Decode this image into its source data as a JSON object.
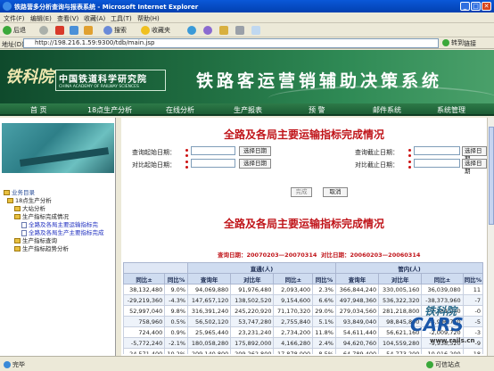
{
  "window": {
    "title": "铁路营多分析查询与报表系统 - Microsoft Internet Explorer",
    "controls": [
      "_",
      "□",
      "✕"
    ]
  },
  "menu": [
    "文件(F)",
    "编辑(E)",
    "查看(V)",
    "收藏(A)",
    "工具(T)",
    "帮助(H)"
  ],
  "toolbar": {
    "back": "后退",
    "search": "搜索",
    "favorites": "收藏夹"
  },
  "address": {
    "label": "地址(D)",
    "url": "http://198.216.1.59:9300/tdb/main.jsp",
    "go": "转到",
    "links": "链接"
  },
  "banner": {
    "logo_script": "铁科院",
    "logo_cn": "中国铁道科学研究院",
    "logo_en": "CHINA ACADEMY OF RAILWAY SCIENCES",
    "system_title": "铁路客运营销辅助决策系统"
  },
  "nav": [
    "首 页",
    "18点生产分析",
    "在线分析",
    "生产报表",
    "预 警",
    "邮件系统",
    "系统管理"
  ],
  "sidebar": {
    "tree": [
      {
        "label": "业务目录",
        "level": 0,
        "type": "root"
      },
      {
        "label": "18点生产分析",
        "level": 1,
        "type": "folder"
      },
      {
        "label": "大站分析",
        "level": 2,
        "type": "folder"
      },
      {
        "label": "生产指标完成情况",
        "level": 2,
        "type": "folder"
      },
      {
        "label": "全路及各局主要运输指标完",
        "level": 3,
        "type": "link"
      },
      {
        "label": "全路及各局生产主要指标完成",
        "level": 3,
        "type": "link"
      },
      {
        "label": "生产指标查询",
        "level": 2,
        "type": "folder"
      },
      {
        "label": "生产指标趋势分析",
        "level": 2,
        "type": "folder"
      }
    ]
  },
  "form": {
    "title": "全路及各局主要运输指标完成情况",
    "query_start_label": "查询起始日期：",
    "query_end_label": "查询截止日期：",
    "compare_start_label": "对比起始日期：",
    "compare_end_label": "对比截止日期：",
    "select_date_button": "选择日期",
    "submit_button": "完成",
    "cancel_button": "取消"
  },
  "report": {
    "title": "全路及各局主要运输指标完成情况",
    "query_date": "查询日期：20070203—20070314",
    "compare_date": "对比日期：20060203—20060314",
    "group_direct": "直通(人)",
    "group_local": "管内(人)",
    "columns": [
      "同比±",
      "同比%",
      "查询年",
      "对比年",
      "同比±",
      "同比%",
      "查询年",
      "对比年",
      "同比±",
      "同比%"
    ],
    "rows": [
      [
        "38,132,480",
        "9.0%",
        "94,069,880",
        "91,976,480",
        "2,093,400",
        "2.3%",
        "366,844,240",
        "330,005,160",
        "36,039,080",
        "11"
      ],
      [
        "-29,219,360",
        "-4.3%",
        "147,657,120",
        "138,502,520",
        "9,154,600",
        "6.6%",
        "497,948,360",
        "536,322,320",
        "-38,373,960",
        "-7"
      ],
      [
        "52,997,040",
        "9.8%",
        "316,391,240",
        "245,220,920",
        "71,170,320",
        "29.0%",
        "279,034,560",
        "281,218,800",
        "-2,184,240",
        "-0"
      ],
      [
        "758,960",
        "0.5%",
        "56,502,120",
        "53,747,280",
        "2,755,840",
        "5.1%",
        "93,849,040",
        "98,845,800",
        "-4,996,760",
        "-5"
      ],
      [
        "724,400",
        "0.9%",
        "25,965,440",
        "23,231,240",
        "2,734,200",
        "11.8%",
        "54,611,440",
        "56,621,160",
        "-2,009,720",
        "-3"
      ],
      [
        "-5,772,240",
        "-2.1%",
        "180,058,280",
        "175,892,000",
        "4,166,280",
        "2.4%",
        "94,620,760",
        "104,559,280",
        "-9,938,520",
        "-9"
      ],
      [
        "24,571,400",
        "10.2%",
        "209,140,800",
        "209,262,800",
        "17,878,000",
        "8.5%",
        "64,789,400",
        "54,773,200",
        "10,016,200",
        "18"
      ]
    ]
  },
  "status": {
    "done": "完毕",
    "zone": "可信站点"
  },
  "watermark": {
    "script": "铁科院",
    "brand": "CARS",
    "site": "www.rails.cn"
  }
}
